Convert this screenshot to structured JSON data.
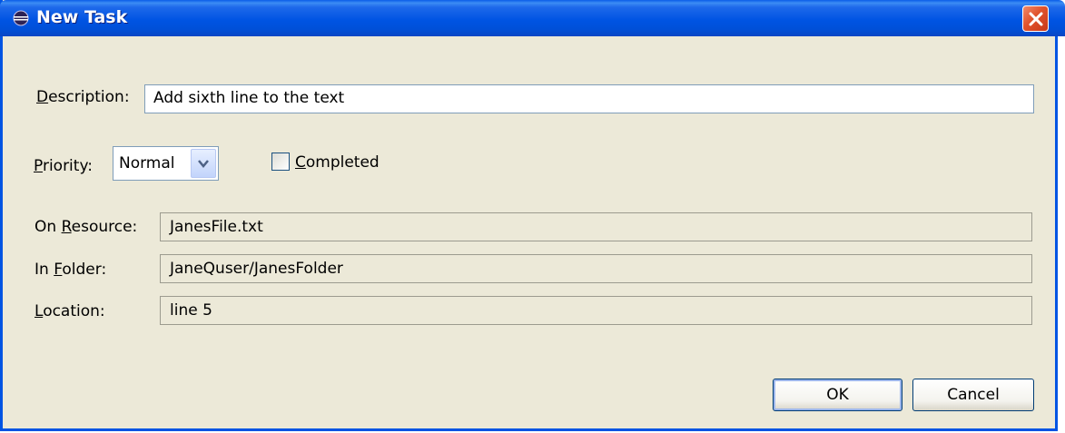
{
  "window": {
    "title": "New Task",
    "icon": "eclipse-icon",
    "close_icon": "close-icon"
  },
  "form": {
    "description": {
      "label_mnemonic": "D",
      "label_rest": "escription:",
      "value": "Add sixth line to the text"
    },
    "priority": {
      "label_mnemonic": "P",
      "label_rest": "riority:",
      "value": "Normal"
    },
    "completed": {
      "label_mnemonic": "C",
      "label_rest": "ompleted",
      "checked": false
    },
    "on_resource": {
      "label_pre": "On ",
      "label_mnemonic": "R",
      "label_rest": "esource:",
      "value": "JanesFile.txt"
    },
    "in_folder": {
      "label_pre": "In ",
      "label_mnemonic": "F",
      "label_rest": "older:",
      "value": "JaneQuser/JanesFolder"
    },
    "location": {
      "label_mnemonic": "L",
      "label_rest": "ocation:",
      "value": "line 5"
    }
  },
  "buttons": {
    "ok": "OK",
    "cancel": "Cancel"
  },
  "colors": {
    "titlebar": "#0054e3",
    "dialog_bg": "#ece9d8",
    "close_button": "#e0522c"
  }
}
